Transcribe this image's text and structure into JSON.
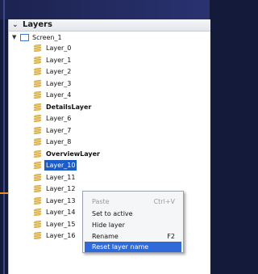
{
  "panel": {
    "title": "Layers"
  },
  "tree": {
    "screen": "Screen_1",
    "layers": [
      {
        "label": "Layer_0",
        "bold": false
      },
      {
        "label": "Layer_1",
        "bold": false
      },
      {
        "label": "Layer_2",
        "bold": false
      },
      {
        "label": "Layer_3",
        "bold": false
      },
      {
        "label": "Layer_4",
        "bold": false
      },
      {
        "label": "DetailsLayer",
        "bold": true
      },
      {
        "label": "Layer_6",
        "bold": false
      },
      {
        "label": "Layer_7",
        "bold": false
      },
      {
        "label": "Layer_8",
        "bold": false
      },
      {
        "label": "OverviewLayer",
        "bold": true
      },
      {
        "label": "Layer_10",
        "bold": false,
        "selected": true
      },
      {
        "label": "Layer_11",
        "bold": false
      },
      {
        "label": "Layer_12",
        "bold": false
      },
      {
        "label": "Layer_13",
        "bold": false
      },
      {
        "label": "Layer_14",
        "bold": false
      },
      {
        "label": "Layer_15",
        "bold": false
      },
      {
        "label": "Layer_16",
        "bold": false
      }
    ]
  },
  "context_menu": {
    "items": [
      {
        "label": "Paste",
        "shortcut": "Ctrl+V",
        "disabled": true
      },
      {
        "label": "Set to active",
        "shortcut": ""
      },
      {
        "label": "Hide layer",
        "shortcut": ""
      },
      {
        "label": "Rename",
        "shortcut": "F2"
      },
      {
        "label": "Reset layer name",
        "shortcut": "",
        "highlighted": true
      }
    ]
  },
  "colors": {
    "accent_arrow": "#f08a1e",
    "selection": "#1b5cc8",
    "menu_highlight": "#2f6ad8",
    "layer_icon": "#e8c25a"
  }
}
